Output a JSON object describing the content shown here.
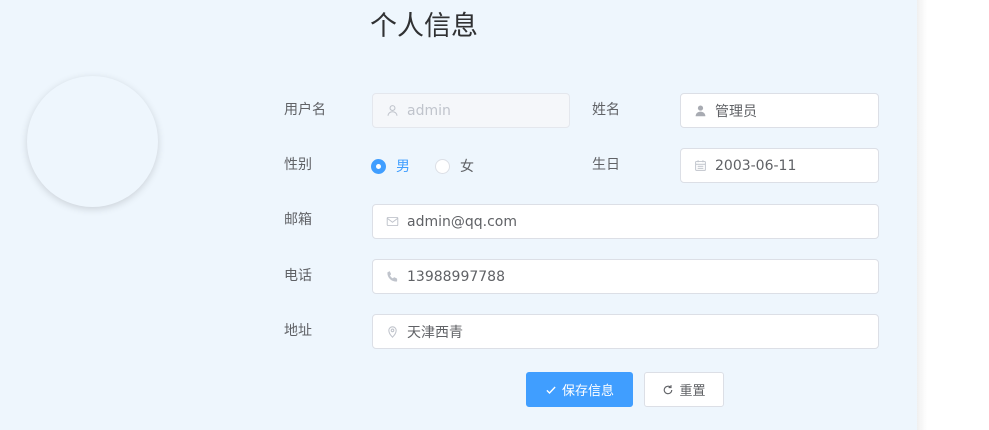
{
  "page": {
    "title": "个人信息"
  },
  "form": {
    "username": {
      "label": "用户名",
      "value": "admin",
      "icon": "user-icon",
      "disabled": true
    },
    "name": {
      "label": "姓名",
      "value": "管理员",
      "icon": "user-icon"
    },
    "gender": {
      "label": "性别",
      "options": [
        {
          "label": "男",
          "checked": true
        },
        {
          "label": "女",
          "checked": false
        }
      ]
    },
    "birthday": {
      "label": "生日",
      "value": "2003-06-11",
      "icon": "calendar-icon"
    },
    "email": {
      "label": "邮箱",
      "value": "admin@qq.com",
      "icon": "mail-icon"
    },
    "phone": {
      "label": "电话",
      "value": "13988997788",
      "icon": "phone-icon"
    },
    "address": {
      "label": "地址",
      "value": "天津西青",
      "icon": "location-icon"
    }
  },
  "actions": {
    "save": {
      "label": "保存信息",
      "icon": "check-icon"
    },
    "reset": {
      "label": "重置",
      "icon": "refresh-icon"
    }
  },
  "colors": {
    "accent": "#409eff",
    "panel_bg": "#eef6fd",
    "border": "#dcdfe6"
  }
}
